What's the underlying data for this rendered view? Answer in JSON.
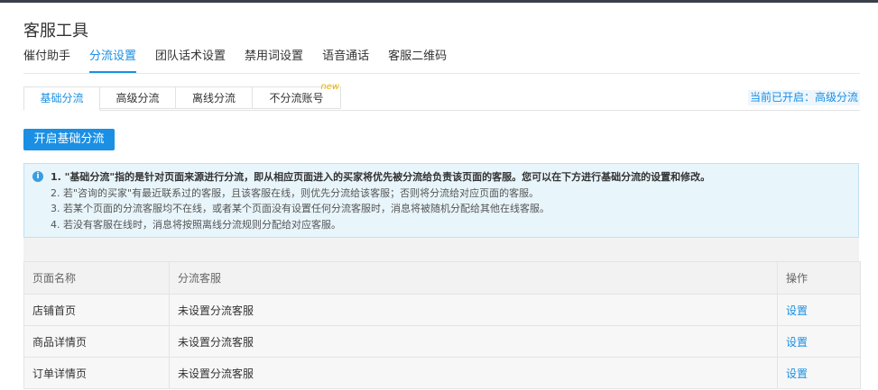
{
  "page_title": "客服工具",
  "main_tabs": [
    {
      "label": "催付助手"
    },
    {
      "label": "分流设置"
    },
    {
      "label": "团队话术设置"
    },
    {
      "label": "禁用词设置"
    },
    {
      "label": "语音通话"
    },
    {
      "label": "客服二维码"
    }
  ],
  "active_main_tab": "分流设置",
  "sub_tabs": [
    {
      "label": "基础分流"
    },
    {
      "label": "高级分流"
    },
    {
      "label": "离线分流"
    },
    {
      "label": "不分流账号",
      "badge": "new"
    }
  ],
  "status_text": "当前已开启：高级分流",
  "enable_button": "开启基础分流",
  "info": {
    "icon": "info-icon",
    "lines": [
      "1. \"基础分流\"指的是针对页面来源进行分流，即从相应页面进入的买家将优先被分流给负责该页面的客服。您可以在下方进行基础分流的设置和修改。",
      "2. 若\"咨询的买家\"有最近联系过的客服，且该客服在线，则优先分流给该客服；否则将分流给对应页面的客服。",
      "3. 若某个页面的分流客服均不在线，或者某个页面没有设置任何分流客服时，消息将被随机分配给其他在线客服。",
      "4. 若没有客服在线时，消息将按照离线分流规则分配给对应客服。"
    ]
  },
  "table": {
    "headers": [
      "页面名称",
      "分流客服",
      "操作"
    ],
    "rows": [
      {
        "page": "店铺首页",
        "agent": "未设置分流客服",
        "action": "设置"
      },
      {
        "page": "商品详情页",
        "agent": "未设置分流客服",
        "action": "设置"
      },
      {
        "page": "订单详情页",
        "agent": "未设置分流客服",
        "action": "设置"
      }
    ]
  },
  "colors": {
    "accent": "#1a8fe3",
    "info_bg": "#e8f5fb",
    "badge": "#e8b400"
  }
}
